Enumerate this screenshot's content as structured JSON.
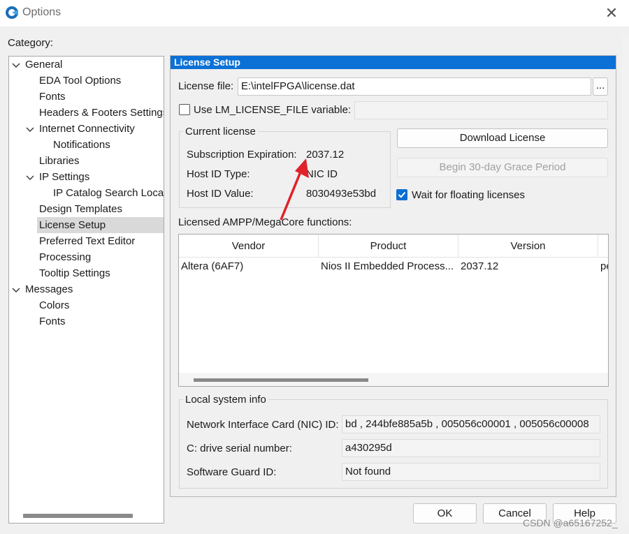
{
  "window": {
    "title": "Options",
    "close_icon": "close-icon"
  },
  "category_label": "Category:",
  "tree": {
    "items": [
      {
        "label": "General",
        "expanded": true
      },
      {
        "label": "EDA Tool Options"
      },
      {
        "label": "Fonts"
      },
      {
        "label": "Headers & Footers Settings"
      },
      {
        "label": "Internet Connectivity",
        "expanded": true
      },
      {
        "label": "Notifications"
      },
      {
        "label": "Libraries"
      },
      {
        "label": "IP Settings",
        "expanded": true
      },
      {
        "label": "IP Catalog Search Locations"
      },
      {
        "label": "Design Templates"
      },
      {
        "label": "License Setup",
        "selected": true
      },
      {
        "label": "Preferred Text Editor"
      },
      {
        "label": "Processing"
      },
      {
        "label": "Tooltip Settings"
      },
      {
        "label": "Messages",
        "expanded": true
      },
      {
        "label": "Colors"
      },
      {
        "label": "Fonts"
      }
    ]
  },
  "panel": {
    "title": "License Setup",
    "license_file_label": "License file:",
    "license_file_value": "E:\\intelFPGA\\license.dat",
    "browse_label": "...",
    "use_env_label": "Use LM_LICENSE_FILE variable:",
    "use_env_checked": false,
    "current_license": {
      "title": "Current license",
      "subscription_label": "Subscription Expiration:",
      "subscription_value": "2037.12",
      "host_type_label": "Host ID Type:",
      "host_type_value": "NIC ID",
      "host_value_label": "Host ID Value:",
      "host_value_value": "8030493e53bd"
    },
    "download_label": "Download License",
    "grace_label": "Begin 30-day Grace Period",
    "wait_label": "Wait for floating licenses",
    "wait_checked": true,
    "ampp_label": "Licensed AMPP/MegaCore functions:",
    "table": {
      "columns": [
        "Vendor",
        "Product",
        "Version"
      ],
      "rows": [
        [
          "Altera (6AF7)",
          "Nios II Embedded Process...",
          "2037.12",
          "pe"
        ]
      ]
    },
    "local_info": {
      "title": "Local system info",
      "nic_label": "Network Interface Card (NIC) ID:",
      "nic_value": "bd , 244bfe885a5b , 005056c00001 , 005056c00008",
      "drive_label": "C: drive serial number:",
      "drive_value": "a430295d",
      "guard_label": "Software Guard ID:",
      "guard_value": "Not found"
    }
  },
  "buttons": {
    "ok": "OK",
    "cancel": "Cancel",
    "help": "Help"
  },
  "watermark": "CSDN @a65167252_",
  "colors": {
    "header_blue": "#0b71d6",
    "annotation_red": "#e0222a",
    "checkbox_blue": "#0b6fd1"
  }
}
